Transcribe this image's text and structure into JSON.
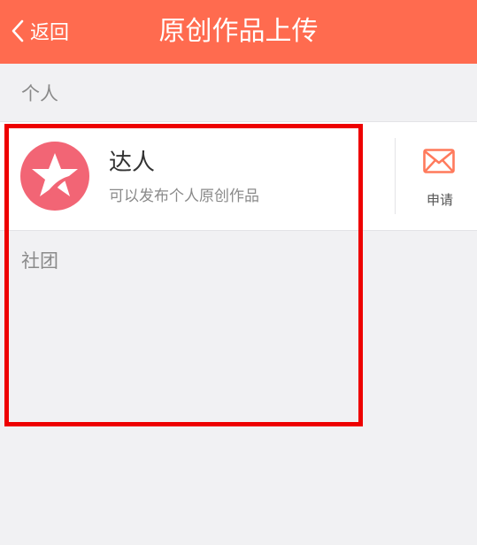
{
  "nav": {
    "back_label": "返回",
    "title": "原创作品上传",
    "bar_color": "#ff6b4f"
  },
  "sections": {
    "personal_label": "个人",
    "club_label": "社团"
  },
  "row": {
    "icon": "star-icon",
    "title": "达人",
    "subtitle": "可以发布个人原创作品",
    "apply_icon": "envelope-icon",
    "apply_label": "申请",
    "accent_color": "#f26575"
  },
  "highlight_color": "#ee0000"
}
